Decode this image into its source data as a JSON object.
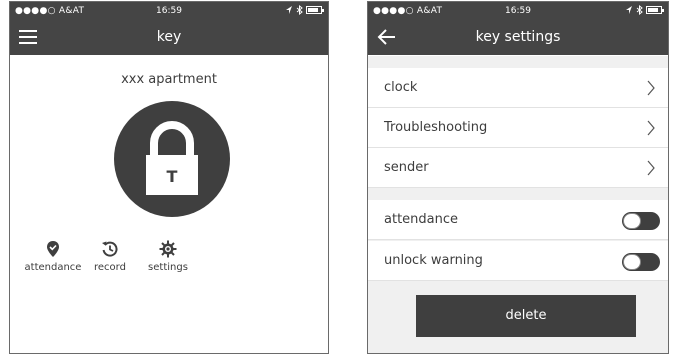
{
  "status_bar": {
    "carrier": "●●●●○ A&AT",
    "time": "16:59"
  },
  "key_screen": {
    "title": "key",
    "apartment": "xxx apartment",
    "lock_letter": "T",
    "actions": [
      {
        "label": "attendance",
        "icon": "location-check-icon"
      },
      {
        "label": "record",
        "icon": "history-icon"
      },
      {
        "label": "settings",
        "icon": "gear-icon"
      }
    ]
  },
  "settings_screen": {
    "title": "key settings",
    "rows": [
      {
        "label": "clock"
      },
      {
        "label": "Troubleshooting"
      },
      {
        "label": "sender"
      }
    ],
    "toggles": [
      {
        "label": "attendance",
        "on": false
      },
      {
        "label": "unlock warning",
        "on": false
      }
    ],
    "delete_label": "delete"
  }
}
